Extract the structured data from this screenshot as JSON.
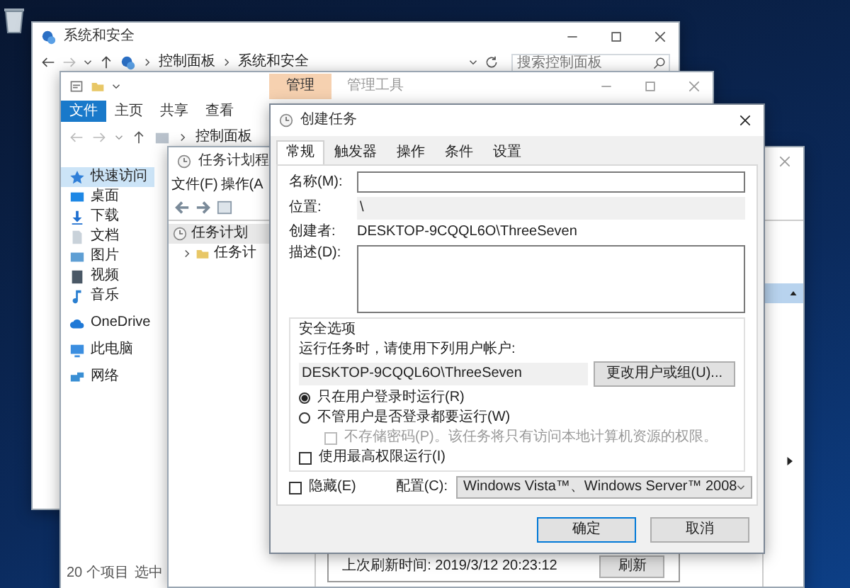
{
  "control_panel_window": {
    "title": "系统和安全",
    "breadcrumb": [
      "控制面板",
      "系统和安全"
    ],
    "search": {
      "placeholder": "搜索控制面板"
    }
  },
  "explorer_window": {
    "context_tab": "管理",
    "title": "管理工具",
    "ribbon_tabs": [
      {
        "label": "文件",
        "selected": true
      },
      {
        "label": "主页",
        "selected": false
      },
      {
        "label": "共享",
        "selected": false
      },
      {
        "label": "查看",
        "selected": false
      }
    ],
    "breadcrumb": [
      "控制面板"
    ],
    "sidebar": [
      {
        "label": "快速访问",
        "selected": true
      },
      {
        "label": "桌面",
        "selected": false
      },
      {
        "label": "下载",
        "selected": false
      },
      {
        "label": "文档",
        "selected": false
      },
      {
        "label": "图片",
        "selected": false
      },
      {
        "label": "视频",
        "selected": false
      },
      {
        "label": "音乐",
        "selected": false
      },
      {
        "label": "OneDrive",
        "selected": false
      },
      {
        "label": "此电脑",
        "selected": false
      },
      {
        "label": "网络",
        "selected": false
      }
    ],
    "status_bar": {
      "item_count": "20 个项目",
      "selection": "选中"
    }
  },
  "scheduler_window": {
    "title": "任务计划程",
    "menu": [
      "文件(F)",
      "操作(A"
    ],
    "tree": [
      {
        "label": "任务计划",
        "children": [
          {
            "label": "任务计",
            "expanded": false
          }
        ]
      }
    ],
    "last_refresh": "上次刷新时间: 2019/3/12 20:23:12",
    "refresh_button": "刷新"
  },
  "dialog": {
    "title": "创建任务",
    "tabs": [
      {
        "label": "常规",
        "selected": true
      },
      {
        "label": "触发器",
        "selected": false
      },
      {
        "label": "操作",
        "selected": false
      },
      {
        "label": "条件",
        "selected": false
      },
      {
        "label": "设置",
        "selected": false
      }
    ],
    "name": {
      "label": "名称(M):"
    },
    "location": {
      "label": "位置:",
      "value": "\\"
    },
    "author": {
      "label": "创建者:",
      "value": "DESKTOP-9CQQL6O\\ThreeSeven"
    },
    "description": {
      "label": "描述(D):"
    },
    "security": {
      "title": "安全选项",
      "prompt": "运行任务时，请使用下列用户帐户:",
      "account": "DESKTOP-9CQQL6O\\ThreeSeven",
      "change_button": "更改用户或组(U)...",
      "run_options": [
        {
          "label": "只在用户登录时运行(R)",
          "selected": true
        },
        {
          "label": "不管用户是否登录都要运行(W)",
          "selected": false
        }
      ],
      "dont_store_password": {
        "label": "不存储密码(P)。该任务将只有访问本地计算机资源的权限。",
        "checked": false,
        "disabled": true
      },
      "highest_privileges": {
        "label": "使用最高权限运行(I)",
        "checked": false
      }
    },
    "hidden": {
      "label": "隐藏(E)",
      "checked": false
    },
    "configure": {
      "label": "配置(C):",
      "value": "Windows Vista™、Windows Server™ 2008"
    },
    "buttons": [
      {
        "label": "确定",
        "default": true
      },
      {
        "label": "取消",
        "default": false
      }
    ]
  }
}
